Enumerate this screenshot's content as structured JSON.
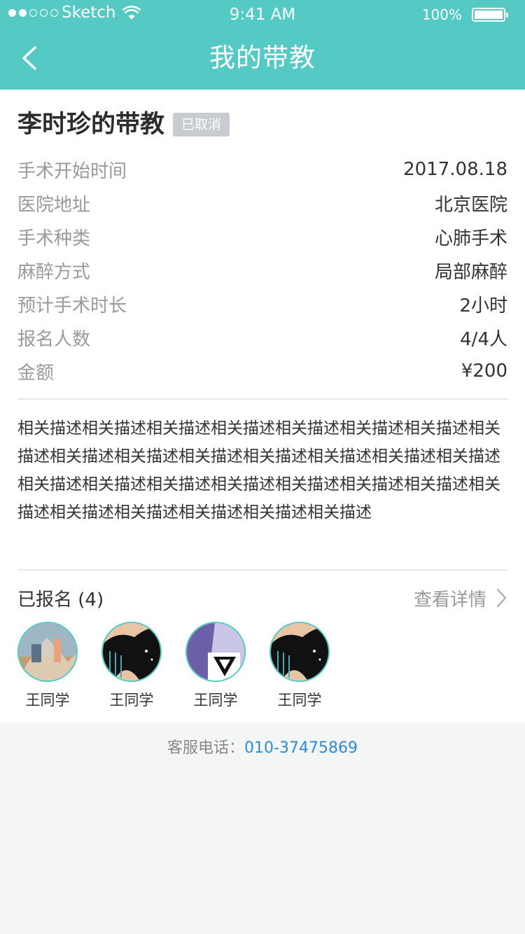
{
  "status_bar": {
    "carrier": "Sketch",
    "time": "9:41 AM",
    "battery": "100%"
  },
  "nav": {
    "title": "我的带教"
  },
  "course": {
    "title": "李时珍的带教",
    "status": "已取消"
  },
  "info": [
    {
      "label": "手术开始时间",
      "value": "2017.08.18"
    },
    {
      "label": "医院地址",
      "value": "北京医院"
    },
    {
      "label": "手术种类",
      "value": "心肺手术"
    },
    {
      "label": "麻醉方式",
      "value": "局部麻醉"
    },
    {
      "label": "预计手术时长",
      "value": "2小时"
    },
    {
      "label": "报名人数",
      "value": "4/4人"
    },
    {
      "label": "金额",
      "value": "¥200"
    }
  ],
  "description": "相关描述相关描述相关描述相关描述相关描述相关描述相关描述相关描述相关描述相关描述相关描述相关描述相关描述相关描述相关描述相关描述相关描述相关描述相关描述相关描述相关描述相关描述相关描述相关描述相关描述相关描述相关描述相关描述",
  "signed": {
    "label": "已报名 (4)",
    "detail_link": "查看详情"
  },
  "students": [
    {
      "name": "王同学"
    },
    {
      "name": "王同学"
    },
    {
      "name": "王同学"
    },
    {
      "name": "王同学"
    }
  ],
  "footer": {
    "label": "客服电话：",
    "phone": "010-37475869"
  }
}
